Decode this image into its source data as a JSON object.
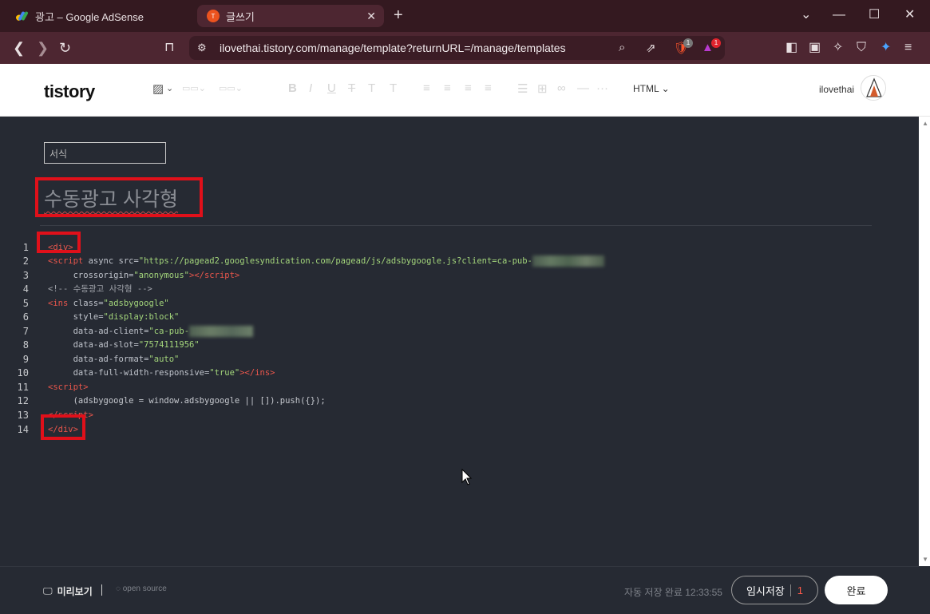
{
  "browser": {
    "tabs": [
      {
        "title": "광고 – Google AdSense",
        "active": false,
        "icon": "adsense-logo-icon"
      },
      {
        "title": "글쓰기",
        "active": true,
        "icon": "tistory-favicon-icon"
      }
    ],
    "url": "ilovethai.tistory.com/manage/template?returnURL=/manage/templates",
    "badges": {
      "brave_shields": "1",
      "rewards": "1"
    }
  },
  "toolbar": {
    "logo": "tistory",
    "mode": "HTML",
    "username": "ilovethai"
  },
  "editor": {
    "format_placeholder": "서식",
    "title": "수동광고 사각형",
    "code_lines": [
      {
        "n": "1",
        "html": "<span class='t'>&lt;div&gt;</span>"
      },
      {
        "n": "2",
        "html": "<span class='t'>&lt;script </span><span class='a'>async src=</span><span class='s'>\"https://pagead2.googlesyndication.com/pagead/js/adsbygoogle.js?client=ca-pub-</span><span class='blur1'></span>"
      },
      {
        "n": "3",
        "html": "     <span class='a'>crossorigin=</span><span class='s'>\"anonymous\"</span><span class='t'>&gt;&lt;/script&gt;</span>"
      },
      {
        "n": "4",
        "html": "<span class='c'>&lt;!-- 수동광고 사각형 --&gt;</span>"
      },
      {
        "n": "5",
        "html": "<span class='t'>&lt;ins </span><span class='a'>class=</span><span class='s'>\"adsbygoogle\"</span>"
      },
      {
        "n": "6",
        "html": "     <span class='a'>style=</span><span class='s'>\"display:block\"</span>"
      },
      {
        "n": "7",
        "html": "     <span class='a'>data-ad-client=</span><span class='s'>\"ca-pub-</span><span class='blur2'></span>"
      },
      {
        "n": "8",
        "html": "     <span class='a'>data-ad-slot=</span><span class='s'>\"7574111956\"</span>"
      },
      {
        "n": "9",
        "html": "     <span class='a'>data-ad-format=</span><span class='s'>\"auto\"</span>"
      },
      {
        "n": "10",
        "html": "     <span class='a'>data-full-width-responsive=</span><span class='s'>\"true\"</span><span class='t'>&gt;&lt;/ins&gt;</span>"
      },
      {
        "n": "11",
        "html": "<span class='t'>&lt;script&gt;</span>"
      },
      {
        "n": "12",
        "html": "     <span class='p'>(adsbygoogle = window.adsbygoogle || []).push({});</span>"
      },
      {
        "n": "13",
        "html": "<span class='t'>&lt;/script&gt;</span>"
      },
      {
        "n": "14",
        "html": "<span class='t'>&lt;/div&gt;</span>"
      }
    ]
  },
  "footer": {
    "preview_label": "미리보기",
    "open_source": "open source",
    "autosave_status": "자동 저장 완료 12:33:55",
    "draft_label": "임시저장",
    "draft_count": "1",
    "done_label": "완료"
  },
  "colors": {
    "highlight": "#e0101a",
    "tag": "#e9564c",
    "string": "#a3d57b"
  }
}
